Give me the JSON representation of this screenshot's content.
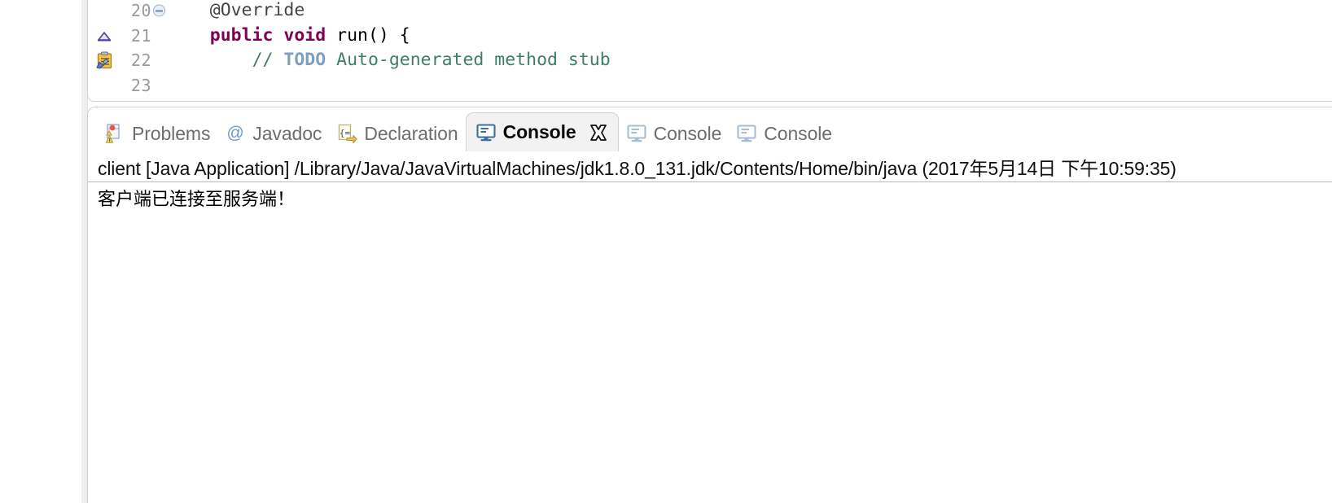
{
  "editor": {
    "lines": [
      {
        "number": "20",
        "marker": "none",
        "fold": true,
        "segments": [
          {
            "text": "    @Override",
            "cls": "anno"
          }
        ]
      },
      {
        "number": "21",
        "marker": "override-arrow-icon",
        "fold": false,
        "segments": [
          {
            "text": "    ",
            "cls": "plain"
          },
          {
            "text": "public",
            "cls": "kw"
          },
          {
            "text": " ",
            "cls": "plain"
          },
          {
            "text": "void",
            "cls": "kw"
          },
          {
            "text": " run() {",
            "cls": "plain"
          }
        ]
      },
      {
        "number": "22",
        "marker": "todo-task-icon",
        "fold": false,
        "segments": [
          {
            "text": "        ",
            "cls": "plain"
          },
          {
            "text": "// ",
            "cls": "cmt"
          },
          {
            "text": "TODO",
            "cls": "todo"
          },
          {
            "text": " Auto-generated method stub",
            "cls": "cmt"
          }
        ]
      },
      {
        "number": "23",
        "marker": "none",
        "fold": false,
        "segments": [
          {
            "text": "",
            "cls": "plain"
          }
        ]
      }
    ]
  },
  "console_panel": {
    "tabs": [
      {
        "label": "Problems",
        "icon": "problems-icon",
        "active": false,
        "closable": false
      },
      {
        "label": "Javadoc",
        "icon": "javadoc-at-icon",
        "active": false,
        "closable": false
      },
      {
        "label": "Declaration",
        "icon": "declaration-icon",
        "active": false,
        "closable": false
      },
      {
        "label": "Console",
        "icon": "console-icon",
        "active": true,
        "closable": true
      },
      {
        "label": "Console",
        "icon": "console-icon",
        "active": false,
        "closable": false
      },
      {
        "label": "Console",
        "icon": "console-icon",
        "active": false,
        "closable": false
      }
    ],
    "header": "client [Java Application] /Library/Java/JavaVirtualMachines/jdk1.8.0_131.jdk/Contents/Home/bin/java (2017年5月14日 下午10:59:35)",
    "output_lines": [
      "客户端已连接至服务端！"
    ]
  },
  "colors": {
    "keyword": "#7f0055",
    "comment": "#3f7f5f",
    "todo": "#7f9fbf",
    "active_tab_bg": "#f2f2f2",
    "inactive_tab_text": "#6d6d6d",
    "console_icon_blue": "#3a6ea5"
  }
}
